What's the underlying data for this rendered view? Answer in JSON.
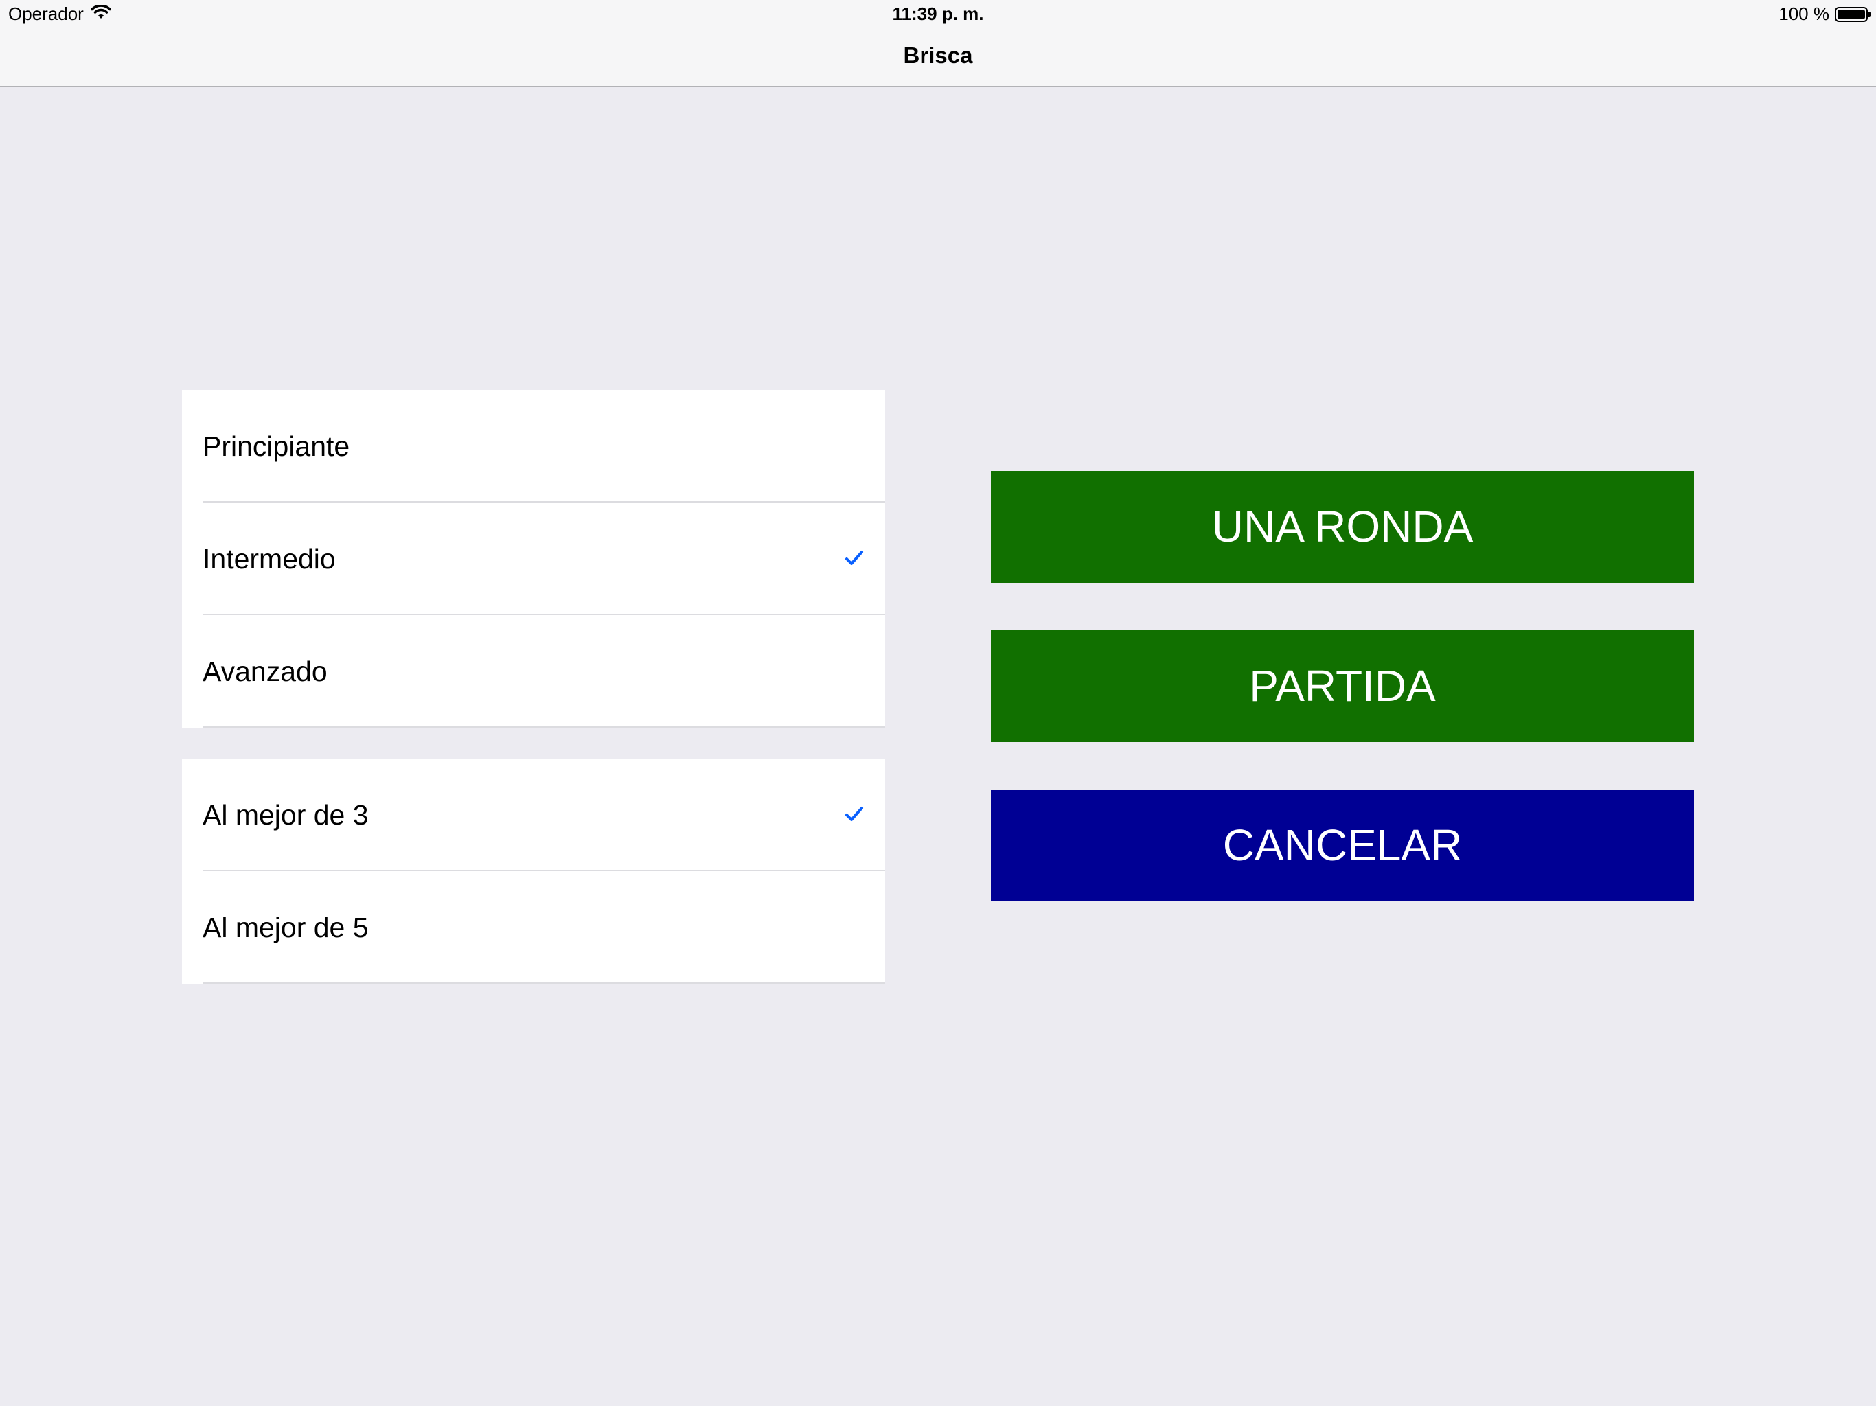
{
  "status_bar": {
    "carrier": "Operador",
    "wifi_icon": "wifi-icon",
    "time": "11:39 p. m.",
    "battery_percent": "100 %",
    "battery_level": 1.0
  },
  "nav": {
    "title": "Brisca"
  },
  "difficulty": {
    "options": [
      {
        "label": "Principiante",
        "selected": false
      },
      {
        "label": "Intermedio",
        "selected": true
      },
      {
        "label": "Avanzado",
        "selected": false
      }
    ]
  },
  "rounds": {
    "options": [
      {
        "label": "Al mejor de 3",
        "selected": true
      },
      {
        "label": "Al mejor de 5",
        "selected": false
      }
    ]
  },
  "actions": {
    "una_ronda": "UNA RONDA",
    "partida": "PARTIDA",
    "cancelar": "CANCELAR"
  },
  "colors": {
    "background": "#ECEBF1",
    "green_button": "#117000",
    "blue_button": "#000094",
    "checkmark": "#0A60FE"
  }
}
